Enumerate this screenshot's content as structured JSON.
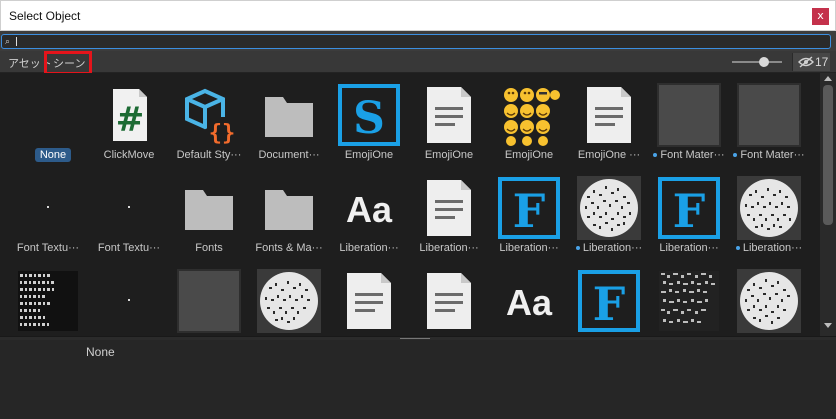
{
  "window": {
    "title": "Select Object",
    "close_label": "x"
  },
  "search": {
    "value": "",
    "placeholder": ""
  },
  "tabs": [
    {
      "label": "アセット"
    },
    {
      "label": "シーン"
    }
  ],
  "visibility_count": "17",
  "items": [
    {
      "label": "None",
      "icon": "none"
    },
    {
      "label": "ClickMove",
      "icon": "csharp-script-icon"
    },
    {
      "label": "Default Sty···",
      "icon": "style-sheet-icon"
    },
    {
      "label": "Document···",
      "icon": "folder-icon"
    },
    {
      "label": "EmojiOne",
      "icon": "sprite-asset-icon"
    },
    {
      "label": "EmojiOne",
      "icon": "text-asset-icon"
    },
    {
      "label": "EmojiOne",
      "icon": "emoji-atlas-icon"
    },
    {
      "label": "EmojiOne ···",
      "icon": "text-asset-icon"
    },
    {
      "label": "Font Mater···",
      "icon": "material-icon"
    },
    {
      "label": "Font Mater···",
      "icon": "material-icon"
    },
    {
      "label": "Font Textu···",
      "icon": "texture-icon"
    },
    {
      "label": "Font Textu···",
      "icon": "texture-icon"
    },
    {
      "label": "Fonts",
      "icon": "folder-icon"
    },
    {
      "label": "Fonts & Ma···",
      "icon": "folder-icon"
    },
    {
      "label": "Liberation···",
      "icon": "font-icon"
    },
    {
      "label": "Liberation···",
      "icon": "text-asset-icon"
    },
    {
      "label": "Liberation···",
      "icon": "font-asset-icon"
    },
    {
      "label": "Liberation···",
      "icon": "font-atlas-icon"
    },
    {
      "label": "Liberation···",
      "icon": "font-asset-icon"
    },
    {
      "label": "Liberation···",
      "icon": "font-atlas-icon"
    },
    {
      "label": "",
      "icon": "font-atlas-texture-icon"
    },
    {
      "label": "",
      "icon": "texture-icon"
    },
    {
      "label": "",
      "icon": "material-icon"
    },
    {
      "label": "",
      "icon": "font-atlas-icon"
    },
    {
      "label": "",
      "icon": "text-asset-icon"
    },
    {
      "label": "",
      "icon": "text-asset-icon"
    },
    {
      "label": "",
      "icon": "font-icon"
    },
    {
      "label": "",
      "icon": "font-asset-icon"
    },
    {
      "label": "",
      "icon": "font-atlas-texture-icon"
    },
    {
      "label": "",
      "icon": "font-atlas-icon"
    }
  ],
  "selection_preview": {
    "label": "None"
  }
}
